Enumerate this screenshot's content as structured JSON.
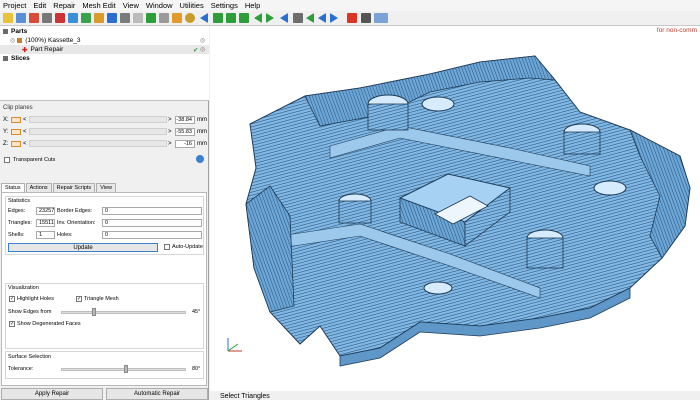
{
  "menu": [
    "Project",
    "Edit",
    "Repair",
    "Mesh Edit",
    "View",
    "Window",
    "Utilities",
    "Settings",
    "Help"
  ],
  "watermark": "for non-comm",
  "tree": {
    "parts_label": "Parts",
    "part_item": "(100%) Kassette_3",
    "repair_item": "Part Repair",
    "slices_label": "Slices"
  },
  "clip": {
    "title": "Clip planes",
    "x_label": "X:",
    "y_label": "Y:",
    "z_label": "Z:",
    "lt": "<",
    "gt": ">",
    "x_value": "-38.84",
    "y_value": "-55.83",
    "z_value": "-16",
    "unit": "mm",
    "transparent_cuts": "Transparent Cuts"
  },
  "tabs": [
    "Status",
    "Actions",
    "Repair Scripts",
    "View"
  ],
  "stats": {
    "title": "Statistics",
    "edges_label": "Edges:",
    "edges_value": "23257",
    "border_edges_label": "Border Edges:",
    "border_edges_value": "0",
    "triangles_label": "Triangles:",
    "triangles_value": "15511",
    "inv_orientation_label": "Inv. Orientation:",
    "inv_orientation_value": "0",
    "shells_label": "Shells:",
    "shells_value": "1",
    "holes_label": "Holes:",
    "holes_value": "0",
    "update_button": "Update",
    "auto_update": "Auto-Update"
  },
  "visualization": {
    "title": "Visualization",
    "highlight_holes": "Highlight Holes",
    "triangle_mesh": "Triangle Mesh",
    "show_edges_from": "Show Edges from",
    "edges_angle": "45°",
    "show_degenerated": "Show Degenerated Faces"
  },
  "surface": {
    "title": "Surface Selection",
    "tolerance_label": "Tolerance:",
    "tolerance_value": "80°"
  },
  "buttons": {
    "apply_repair": "Apply Repair",
    "automatic_repair": "Automatic Repair"
  },
  "bottom_tab": "Select Triangles",
  "colors": {
    "mesh_blue": "#7fb8e6",
    "mesh_edge": "#1f3a56",
    "accent_green": "#2e9e3a",
    "accent_blue": "#2a6fd0"
  }
}
